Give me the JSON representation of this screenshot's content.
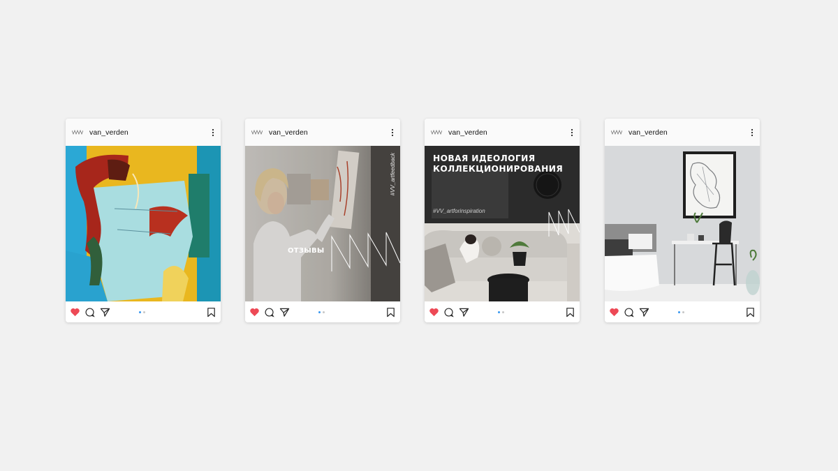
{
  "colors": {
    "background": "#f1f1f1",
    "like_red": "#ed4956",
    "dot_active": "#3897f0",
    "dot_inactive": "#c7c7c7"
  },
  "posts": [
    {
      "username": "van_verden",
      "image_subject": "abstract expressionist painting with yellow, blue and red",
      "liked": true,
      "carousel_index": 1,
      "carousel_count": 2
    },
    {
      "username": "van_verden",
      "image_subject": "woman examining an artwork in a gallery",
      "overlay_label": "ОТЗЫВЫ",
      "hashtag": "#VV_artfeedback",
      "liked": true,
      "carousel_index": 1,
      "carousel_count": 2
    },
    {
      "username": "van_verden",
      "image_subject": "living room with sofa and dog, dark header panel",
      "headline": "НОВАЯ ИДЕОЛОГИЯ КОЛЛЕКЦИОНИРОВАНИЯ",
      "hashtag": "#VV_artforinspiration",
      "liked": true,
      "carousel_index": 1,
      "carousel_count": 2
    },
    {
      "username": "van_verden",
      "image_subject": "bright bedroom with framed sketch and desk",
      "liked": true,
      "carousel_index": 1,
      "carousel_count": 2
    }
  ],
  "icons": {
    "avatar": "van-verden-logo-icon",
    "more": "vertical-ellipsis-icon",
    "like": "heart-icon",
    "comment": "comment-icon",
    "share": "paper-plane-icon",
    "save": "bookmark-icon"
  }
}
